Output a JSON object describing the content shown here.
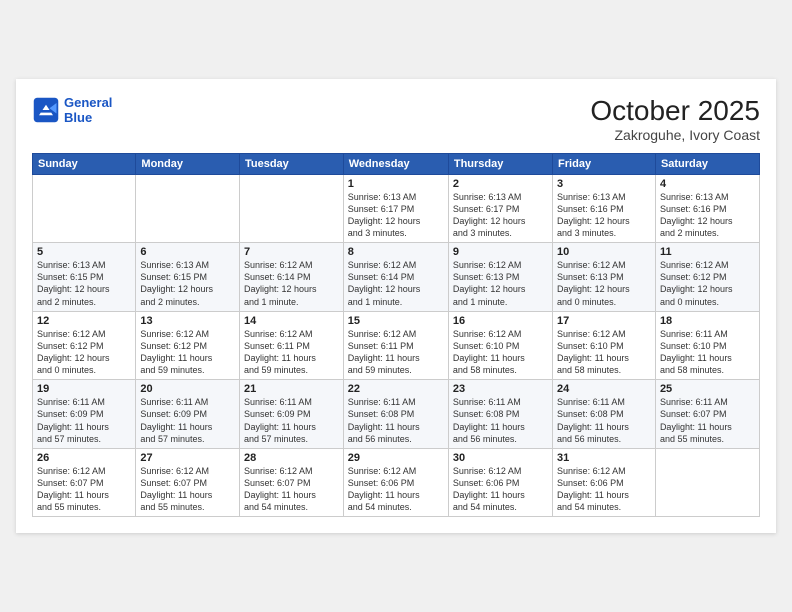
{
  "header": {
    "logo_line1": "General",
    "logo_line2": "Blue",
    "month": "October 2025",
    "location": "Zakroguhe, Ivory Coast"
  },
  "weekdays": [
    "Sunday",
    "Monday",
    "Tuesday",
    "Wednesday",
    "Thursday",
    "Friday",
    "Saturday"
  ],
  "weeks": [
    [
      {
        "day": "",
        "info": ""
      },
      {
        "day": "",
        "info": ""
      },
      {
        "day": "",
        "info": ""
      },
      {
        "day": "1",
        "info": "Sunrise: 6:13 AM\nSunset: 6:17 PM\nDaylight: 12 hours\nand 3 minutes."
      },
      {
        "day": "2",
        "info": "Sunrise: 6:13 AM\nSunset: 6:17 PM\nDaylight: 12 hours\nand 3 minutes."
      },
      {
        "day": "3",
        "info": "Sunrise: 6:13 AM\nSunset: 6:16 PM\nDaylight: 12 hours\nand 3 minutes."
      },
      {
        "day": "4",
        "info": "Sunrise: 6:13 AM\nSunset: 6:16 PM\nDaylight: 12 hours\nand 2 minutes."
      }
    ],
    [
      {
        "day": "5",
        "info": "Sunrise: 6:13 AM\nSunset: 6:15 PM\nDaylight: 12 hours\nand 2 minutes."
      },
      {
        "day": "6",
        "info": "Sunrise: 6:13 AM\nSunset: 6:15 PM\nDaylight: 12 hours\nand 2 minutes."
      },
      {
        "day": "7",
        "info": "Sunrise: 6:12 AM\nSunset: 6:14 PM\nDaylight: 12 hours\nand 1 minute."
      },
      {
        "day": "8",
        "info": "Sunrise: 6:12 AM\nSunset: 6:14 PM\nDaylight: 12 hours\nand 1 minute."
      },
      {
        "day": "9",
        "info": "Sunrise: 6:12 AM\nSunset: 6:13 PM\nDaylight: 12 hours\nand 1 minute."
      },
      {
        "day": "10",
        "info": "Sunrise: 6:12 AM\nSunset: 6:13 PM\nDaylight: 12 hours\nand 0 minutes."
      },
      {
        "day": "11",
        "info": "Sunrise: 6:12 AM\nSunset: 6:12 PM\nDaylight: 12 hours\nand 0 minutes."
      }
    ],
    [
      {
        "day": "12",
        "info": "Sunrise: 6:12 AM\nSunset: 6:12 PM\nDaylight: 12 hours\nand 0 minutes."
      },
      {
        "day": "13",
        "info": "Sunrise: 6:12 AM\nSunset: 6:12 PM\nDaylight: 11 hours\nand 59 minutes."
      },
      {
        "day": "14",
        "info": "Sunrise: 6:12 AM\nSunset: 6:11 PM\nDaylight: 11 hours\nand 59 minutes."
      },
      {
        "day": "15",
        "info": "Sunrise: 6:12 AM\nSunset: 6:11 PM\nDaylight: 11 hours\nand 59 minutes."
      },
      {
        "day": "16",
        "info": "Sunrise: 6:12 AM\nSunset: 6:10 PM\nDaylight: 11 hours\nand 58 minutes."
      },
      {
        "day": "17",
        "info": "Sunrise: 6:12 AM\nSunset: 6:10 PM\nDaylight: 11 hours\nand 58 minutes."
      },
      {
        "day": "18",
        "info": "Sunrise: 6:11 AM\nSunset: 6:10 PM\nDaylight: 11 hours\nand 58 minutes."
      }
    ],
    [
      {
        "day": "19",
        "info": "Sunrise: 6:11 AM\nSunset: 6:09 PM\nDaylight: 11 hours\nand 57 minutes."
      },
      {
        "day": "20",
        "info": "Sunrise: 6:11 AM\nSunset: 6:09 PM\nDaylight: 11 hours\nand 57 minutes."
      },
      {
        "day": "21",
        "info": "Sunrise: 6:11 AM\nSunset: 6:09 PM\nDaylight: 11 hours\nand 57 minutes."
      },
      {
        "day": "22",
        "info": "Sunrise: 6:11 AM\nSunset: 6:08 PM\nDaylight: 11 hours\nand 56 minutes."
      },
      {
        "day": "23",
        "info": "Sunrise: 6:11 AM\nSunset: 6:08 PM\nDaylight: 11 hours\nand 56 minutes."
      },
      {
        "day": "24",
        "info": "Sunrise: 6:11 AM\nSunset: 6:08 PM\nDaylight: 11 hours\nand 56 minutes."
      },
      {
        "day": "25",
        "info": "Sunrise: 6:11 AM\nSunset: 6:07 PM\nDaylight: 11 hours\nand 55 minutes."
      }
    ],
    [
      {
        "day": "26",
        "info": "Sunrise: 6:12 AM\nSunset: 6:07 PM\nDaylight: 11 hours\nand 55 minutes."
      },
      {
        "day": "27",
        "info": "Sunrise: 6:12 AM\nSunset: 6:07 PM\nDaylight: 11 hours\nand 55 minutes."
      },
      {
        "day": "28",
        "info": "Sunrise: 6:12 AM\nSunset: 6:07 PM\nDaylight: 11 hours\nand 54 minutes."
      },
      {
        "day": "29",
        "info": "Sunrise: 6:12 AM\nSunset: 6:06 PM\nDaylight: 11 hours\nand 54 minutes."
      },
      {
        "day": "30",
        "info": "Sunrise: 6:12 AM\nSunset: 6:06 PM\nDaylight: 11 hours\nand 54 minutes."
      },
      {
        "day": "31",
        "info": "Sunrise: 6:12 AM\nSunset: 6:06 PM\nDaylight: 11 hours\nand 54 minutes."
      },
      {
        "day": "",
        "info": ""
      }
    ]
  ]
}
